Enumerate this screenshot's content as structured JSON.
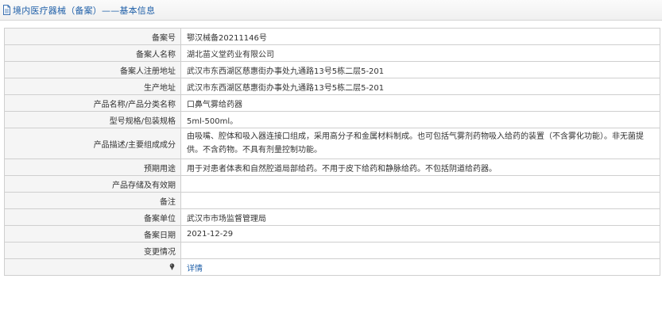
{
  "header": {
    "title": "境内医疗器械（备案）——基本信息",
    "icon": "document-icon"
  },
  "rows": [
    {
      "label": "备案号",
      "value": "鄂汉械备20211146号"
    },
    {
      "label": "备案人名称",
      "value": "湖北苗义堂药业有限公司"
    },
    {
      "label": "备案人注册地址",
      "value": "武汉市东西湖区慈惠街办事处九通路13号5栋二层5-201"
    },
    {
      "label": "生产地址",
      "value": "武汉市东西湖区慈惠街办事处九通路13号5栋二层5-201"
    },
    {
      "label": "产品名称/产品分类名称",
      "value": "口鼻气雾给药器"
    },
    {
      "label": "型号规格/包装规格",
      "value": "5ml-500ml。"
    },
    {
      "label": "产品描述/主要组成成分",
      "value": "由吸嘴、腔体和吸入器连接口组成，采用高分子和金属材料制成。也可包括气雾剂药物吸入给药的装置（不含雾化功能）。非无菌提供。不含药物。不具有剂量控制功能。"
    },
    {
      "label": "预期用途",
      "value": "用于对患者体表和自然腔道局部给药。不用于皮下给药和静脉给药。不包括阴道给药器。"
    },
    {
      "label": "产品存储及有效期",
      "value": ""
    },
    {
      "label": "备注",
      "value": ""
    },
    {
      "label": "备案单位",
      "value": "武汉市市场监督管理局"
    },
    {
      "label": "备案日期",
      "value": "2021-12-29"
    },
    {
      "label": "变更情况",
      "value": ""
    }
  ],
  "footer_row": {
    "icon": "pin-icon",
    "link_label": "详情"
  },
  "colors": {
    "title_blue": "#1f5fa8",
    "label_bg": "#f5f5f5",
    "border": "#cfcfcf"
  }
}
